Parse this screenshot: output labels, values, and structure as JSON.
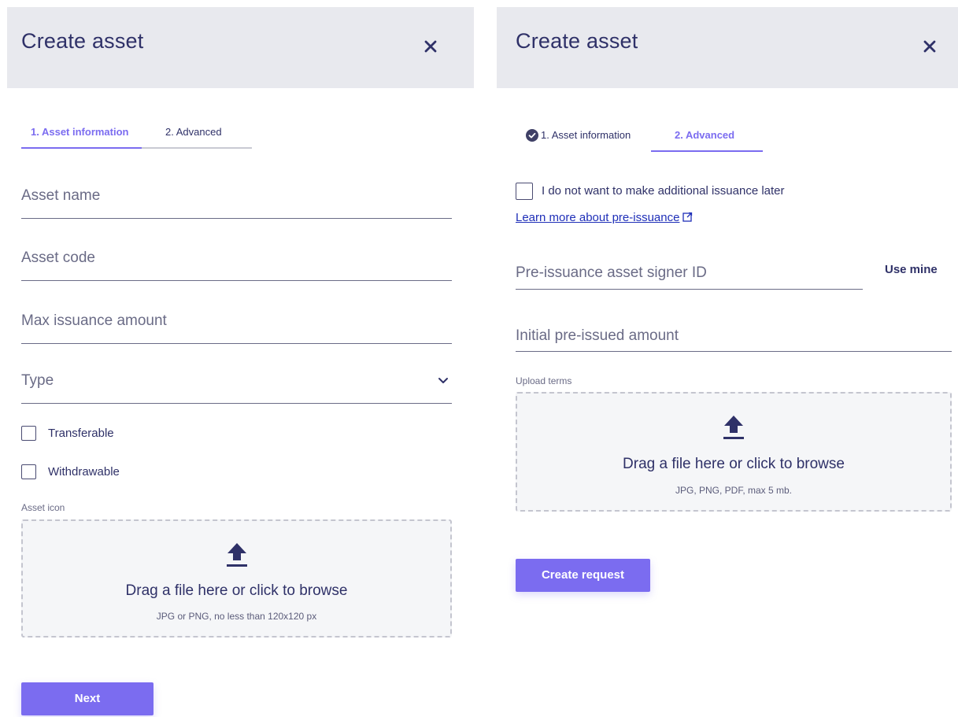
{
  "left_panel": {
    "title": "Create asset",
    "tabs": [
      {
        "label": "1. Asset information",
        "active": true
      },
      {
        "label": "2. Advanced",
        "active": false
      }
    ],
    "fields": {
      "asset_name_placeholder": "Asset name",
      "asset_code_placeholder": "Asset code",
      "max_issuance_placeholder": "Max issuance amount",
      "type_placeholder": "Type"
    },
    "checkboxes": [
      {
        "label": "Transferable",
        "checked": false
      },
      {
        "label": "Withdrawable",
        "checked": false
      }
    ],
    "asset_icon_label": "Asset icon",
    "dropzone": {
      "title": "Drag a file here or click to browse",
      "hint": "JPG or PNG, no less than 120x120 px"
    },
    "next_label": "Next"
  },
  "right_panel": {
    "title": "Create asset",
    "tabs": [
      {
        "label": "1. Asset information",
        "completed": true
      },
      {
        "label": "2. Advanced",
        "active": true
      }
    ],
    "no_additional_issuance": {
      "label": "I do not want to make additional issuance later",
      "checked": false
    },
    "learn_more_link": "Learn more about pre-issuance",
    "signer_placeholder": "Pre-issuance asset signer ID",
    "use_mine_label": "Use mine",
    "initial_amount_placeholder": "Initial pre-issued amount",
    "upload_terms_label": "Upload terms",
    "dropzone": {
      "title": "Drag a file here or click to browse",
      "hint": "JPG, PNG, PDF, max 5 mb."
    },
    "create_label": "Create request"
  },
  "colors": {
    "accent": "#7b6cf0",
    "header_bg": "#e8e9ee",
    "text_primary": "#2f3168",
    "link": "#1f2fb8"
  },
  "icons": [
    "close-icon",
    "chevron-down-icon",
    "upload-icon",
    "check-circle-icon",
    "external-link-icon"
  ]
}
